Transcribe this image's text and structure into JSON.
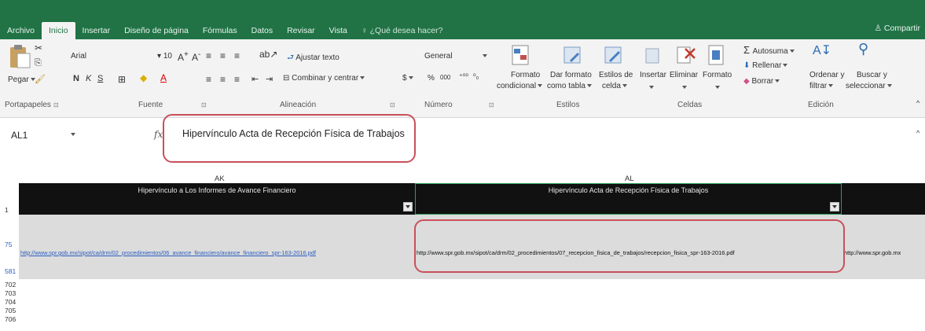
{
  "tabs": [
    "Archivo",
    "Inicio",
    "Insertar",
    "Diseño de página",
    "Fórmulas",
    "Datos",
    "Revisar",
    "Vista",
    "¿Qué desea hacer?"
  ],
  "share": "Compartir",
  "ribbon": {
    "paste": "Pegar",
    "font_name": "Arial",
    "font_size": "10",
    "bold": "N",
    "italic": "K",
    "underline": "S",
    "wrap_text": "Ajustar texto",
    "merge_center": "Combinar y centrar",
    "number_format": "General",
    "currency": "$",
    "percent": "%",
    "thousands": "000",
    "conditional_format_1": "Formato",
    "conditional_format_2": "condicional",
    "format_table_1": "Dar formato",
    "format_table_2": "como tabla",
    "cell_styles_1": "Estilos de",
    "cell_styles_2": "celda",
    "insert": "Insertar",
    "delete": "Eliminar",
    "format": "Formato",
    "autosum": "Autosuma",
    "fill": "Rellenar",
    "clear": "Borrar",
    "sort_1": "Ordenar y",
    "sort_2": "filtrar",
    "find_1": "Buscar y",
    "find_2": "seleccionar",
    "groups": {
      "clipboard": "Portapapeles",
      "font": "Fuente",
      "alignment": "Alineación",
      "number": "Número",
      "styles": "Estilos",
      "cells": "Celdas",
      "editing": "Edición"
    }
  },
  "formula_bar": {
    "name_box": "AL1",
    "fx": "fx",
    "content": "Hipervínculo Acta de Recepción Física de Trabajos"
  },
  "sheet": {
    "col_ak": "AK",
    "col_al": "AL",
    "header_ak": "Hipervínculo a Los Informes de Avance Financiero",
    "header_al": "Hipervínculo Acta de Recepción Física de Trabajos",
    "rows": [
      "1",
      "75",
      "581",
      "702",
      "703",
      "704",
      "705",
      "706"
    ],
    "link_ak": "http://www.spr.gob.mx/sipot/ca/drm/02_procedimientos/06_avance_financiero/avance_financiero_spr-163-2016.pdf",
    "link_al": "http://www.spr.gob.mx/sipot/ca/drm/02_procedimientos/07_recepcion_fisica_de_trabajos/recepcion_fisica_spr-163-2016.pdf",
    "link_am": "http://www.spr.gob.mx"
  },
  "colors": {
    "excel_green": "#217346",
    "annotation_red": "#c8505a",
    "link_blue": "#2d5fc0"
  }
}
